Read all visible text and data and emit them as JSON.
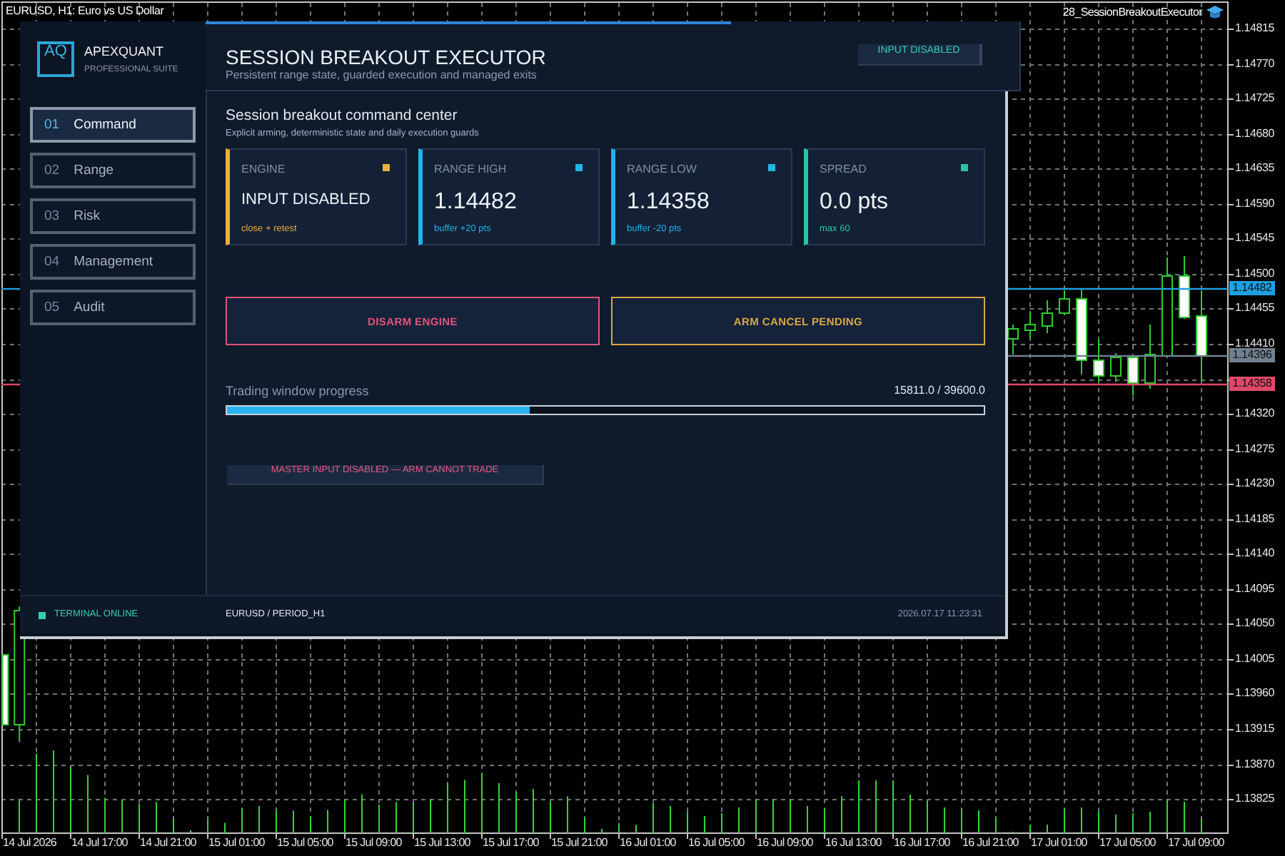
{
  "chart": {
    "title": "EURUSD, H1: Euro vs US Dollar",
    "expert": "28_SessionBreakoutExecutor",
    "price_labels": [
      "1.14815",
      "1.14770",
      "1.14725",
      "1.14680",
      "1.14635",
      "1.14590",
      "1.14545",
      "1.14500",
      "1.14455",
      "1.14410",
      "1.14320",
      "1.14275",
      "1.14230",
      "1.14185",
      "1.14140",
      "1.14095",
      "1.14050",
      "1.14005",
      "1.13960",
      "1.13915",
      "1.13870",
      "1.13825"
    ],
    "price_tags": [
      {
        "text": "1.14482",
        "color": "#1e9fe0"
      },
      {
        "text": "1.14396",
        "color": "#708090"
      },
      {
        "text": "1.14358",
        "color": "#e04868"
      }
    ],
    "time_labels": [
      "14 Jul 2026",
      "14 Jul 17:00",
      "14 Jul 21:00",
      "15 Jul 01:00",
      "15 Jul 05:00",
      "15 Jul 09:00",
      "15 Jul 13:00",
      "15 Jul 17:00",
      "15 Jul 21:00",
      "16 Jul 01:00",
      "16 Jul 05:00",
      "16 Jul 09:00",
      "16 Jul 13:00",
      "16 Jul 17:00",
      "16 Jul 21:00",
      "17 Jul 01:00",
      "17 Jul 05:00",
      "17 Jul 09:00"
    ]
  },
  "panel": {
    "brand": {
      "logo": "AQ",
      "name": "APEXQUANT",
      "tagline": "PROFESSIONAL SUITE"
    },
    "nav": [
      {
        "number": "01",
        "label": "Command",
        "selected": true
      },
      {
        "number": "02",
        "label": "Range",
        "selected": false
      },
      {
        "number": "03",
        "label": "Risk",
        "selected": false
      },
      {
        "number": "04",
        "label": "Management",
        "selected": false
      },
      {
        "number": "05",
        "label": "Audit",
        "selected": false
      }
    ],
    "header": {
      "title": "SESSION BREAKOUT EXECUTOR",
      "subtitle": "Persistent range state, guarded execution and managed exits",
      "badge": "INPUT DISABLED"
    },
    "section": {
      "title": "Session breakout command center",
      "subtitle": "Explicit arming, deterministic state and daily execution guards"
    },
    "cards": [
      {
        "label": "ENGINE",
        "value": "INPUT DISABLED",
        "note": "close + retest",
        "kind": "text",
        "color": "#e8b03c"
      },
      {
        "label": "RANGE HIGH",
        "value": "1.14482",
        "note": "buffer +20 pts",
        "kind": "number",
        "color": "#22b4e6"
      },
      {
        "label": "RANGE LOW",
        "value": "1.14358",
        "note": "buffer -20 pts",
        "kind": "number",
        "color": "#22b4e6"
      },
      {
        "label": "SPREAD",
        "value": "0.0 pts",
        "note": "max 60",
        "kind": "number",
        "color": "#2cc4a0"
      }
    ],
    "buttons": [
      {
        "label": "DISARM ENGINE",
        "color": "#e0557a"
      },
      {
        "label": "ARM CANCEL PENDING",
        "color": "#d9a845"
      }
    ],
    "progress": {
      "label": "Trading window progress",
      "reading": "15811.0 / 39600.0",
      "level": 0.3993
    },
    "warning": "MASTER INPUT DISABLED — ARM CANNOT TRADE",
    "status_bar": {
      "connection": "TERMINAL ONLINE",
      "online": true,
      "symbol": "EURUSD / PERIOD_H1",
      "time": "2026.07.17 11:23:31"
    }
  }
}
